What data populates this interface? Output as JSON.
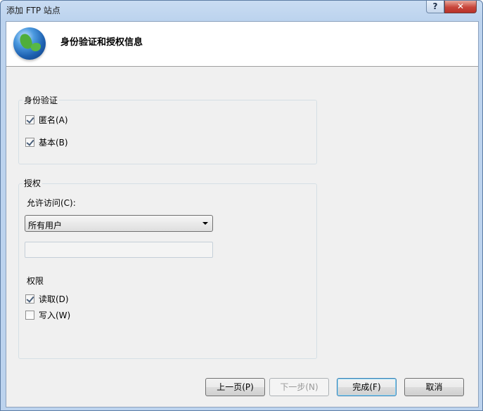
{
  "window": {
    "title": "添加 FTP 站点",
    "help_label": "?",
    "close_label": "✕"
  },
  "header": {
    "icon": "globe-icon",
    "title": "身份验证和授权信息"
  },
  "authentication": {
    "group_label": "身份验证",
    "anonymous": {
      "label": "匿名(A)",
      "checked": true
    },
    "basic": {
      "label": "基本(B)",
      "checked": true
    }
  },
  "authorization": {
    "group_label": "授权",
    "allow_access_label": "允许访问(C):",
    "allow_access_value": "所有用户",
    "user_input_value": "",
    "permissions_label": "权限",
    "read": {
      "label": "读取(D)",
      "checked": true
    },
    "write": {
      "label": "写入(W)",
      "checked": false
    }
  },
  "buttons": {
    "previous": "上一页(P)",
    "next": "下一步(N)",
    "finish": "完成(F)",
    "cancel": "取消"
  },
  "colors": {
    "title_bar": "#bcd3ee",
    "close_button": "#c7453a",
    "dialog_background": "#f0f0f0"
  }
}
